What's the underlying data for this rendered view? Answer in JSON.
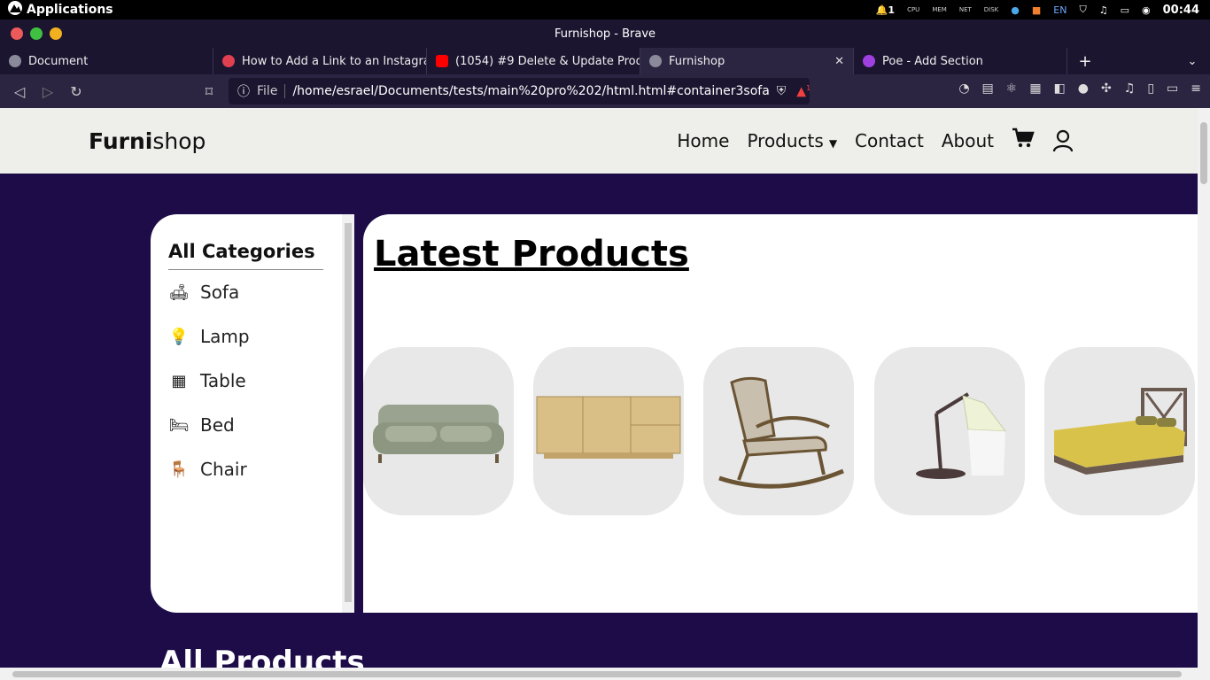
{
  "system": {
    "apps_label": "Applications",
    "notif_count": "1",
    "cpu": "CPU",
    "mem": "MEM",
    "net": "NET",
    "disk": "DISK",
    "lang": "EN",
    "clock": "00:44"
  },
  "window": {
    "title": "Furnishop - Brave"
  },
  "tabs": [
    {
      "label": "Document",
      "icon": "globe-icon"
    },
    {
      "label": "How to Add a Link to an Instagram",
      "icon": "reddit-icon"
    },
    {
      "label": "(1054) #9 Delete & Update Produc",
      "icon": "youtube-icon"
    },
    {
      "label": "Furnishop",
      "icon": "globe-icon"
    },
    {
      "label": "Poe - Add Section",
      "icon": "poe-icon"
    }
  ],
  "address": {
    "scheme_label": "File",
    "url": "/home/esrael/Documents/tests/main%20pro%202/html.html#container3sofa",
    "badge": "1"
  },
  "site": {
    "logo_bold": "Furni",
    "logo_rest": "shop",
    "nav": [
      "Home",
      "Products",
      "Contact",
      "About"
    ],
    "sidebar_title": "All Categories",
    "categories": [
      {
        "label": "Sofa",
        "icon": "sofa-icon"
      },
      {
        "label": "Lamp",
        "icon": "lightbulb-icon"
      },
      {
        "label": "Table",
        "icon": "table-icon"
      },
      {
        "label": "Bed",
        "icon": "bed-icon"
      },
      {
        "label": "Chair",
        "icon": "chair-icon"
      }
    ],
    "latest_title": "Latest Products",
    "products": [
      "sofa",
      "sideboard",
      "rocking-chair",
      "desk-lamp",
      "bed"
    ],
    "all_title": "All Products"
  },
  "colors": {
    "page_bg": "#1e0c48",
    "header_bg": "#eeeeea",
    "card_bg": "#e8e8e8"
  }
}
